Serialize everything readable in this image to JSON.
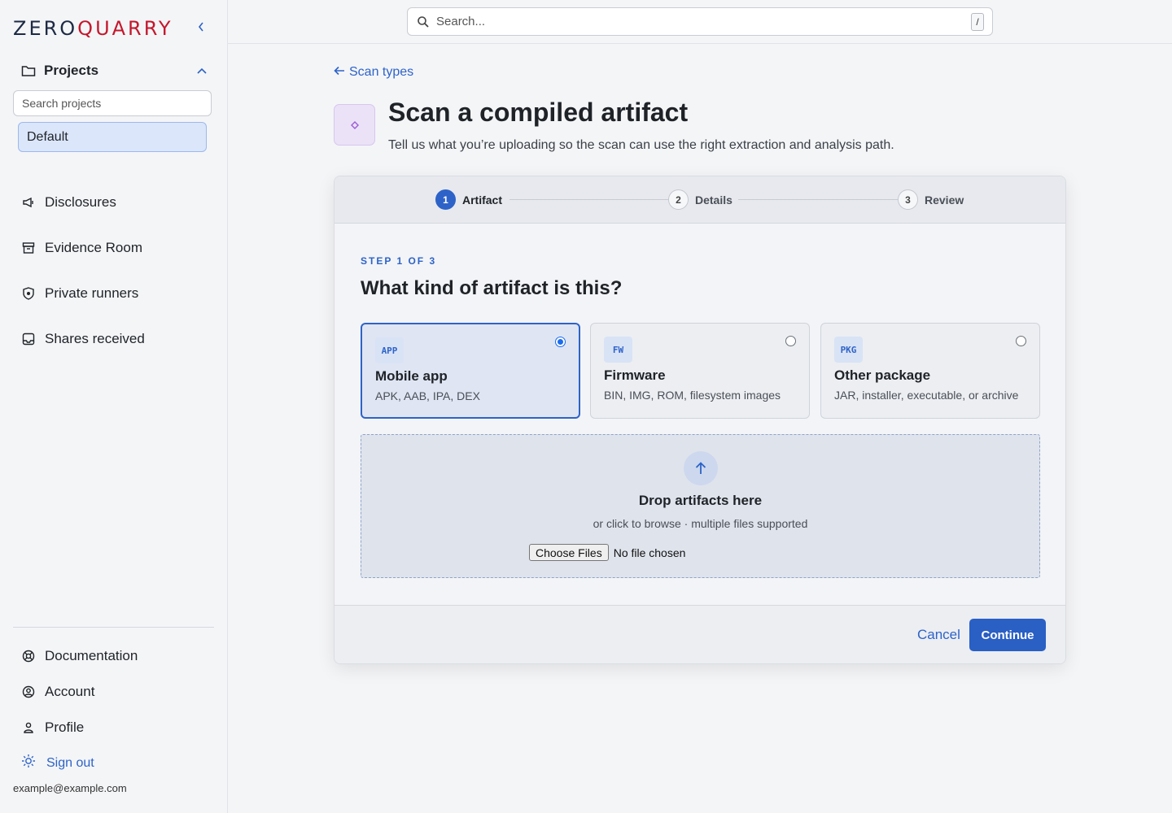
{
  "brand": {
    "name_part1": "ZERO",
    "name_part2": "QUARRY",
    "accent": "#c4172c",
    "primary": "#2d63c8"
  },
  "sidebar": {
    "collapse_icon": "chevron-left-icon",
    "projects": {
      "label": "Projects",
      "search_placeholder": "Search projects",
      "items": [
        {
          "label": "Default",
          "selected": true
        }
      ]
    },
    "nav": [
      {
        "label": "Disclosures",
        "icon": "megaphone-icon"
      },
      {
        "label": "Evidence Room",
        "icon": "archive-box-icon"
      },
      {
        "label": "Private runners",
        "icon": "shield-icon"
      },
      {
        "label": "Shares received",
        "icon": "inbox-icon"
      }
    ],
    "bottom_nav": [
      {
        "label": "Documentation",
        "icon": "lifebuoy-icon"
      },
      {
        "label": "Account",
        "icon": "user-circle-icon"
      },
      {
        "label": "Profile",
        "icon": "user-icon"
      }
    ],
    "sign_out": "Sign out",
    "user_email": "example@example.com"
  },
  "topbar": {
    "search_placeholder": "Search...",
    "shortcut": "/"
  },
  "main": {
    "back_link": "Scan types",
    "title": "Scan a compiled artifact",
    "subtitle": "Tell us what you’re uploading so the scan can use the right extraction and analysis path."
  },
  "stepper": {
    "steps": [
      {
        "num": "1",
        "label": "Artifact",
        "active": true
      },
      {
        "num": "2",
        "label": "Details",
        "active": false
      },
      {
        "num": "3",
        "label": "Review",
        "active": false
      }
    ]
  },
  "step": {
    "kicker": "STEP 1 OF 3",
    "question": "What kind of artifact is this?",
    "options": [
      {
        "badge": "APP",
        "title": "Mobile app",
        "desc": "APK, AAB, IPA, DEX",
        "selected": true
      },
      {
        "badge": "FW",
        "title": "Firmware",
        "desc": "BIN, IMG, ROM, filesystem images",
        "selected": false
      },
      {
        "badge": "PKG",
        "title": "Other package",
        "desc": "JAR, installer, executable, or archive",
        "selected": false
      }
    ]
  },
  "dropzone": {
    "title": "Drop artifacts here",
    "subtitle": "or click to browse · multiple files supported",
    "choose_label": "Choose Files",
    "file_status": "No file chosen"
  },
  "footer": {
    "cancel": "Cancel",
    "continue": "Continue"
  }
}
